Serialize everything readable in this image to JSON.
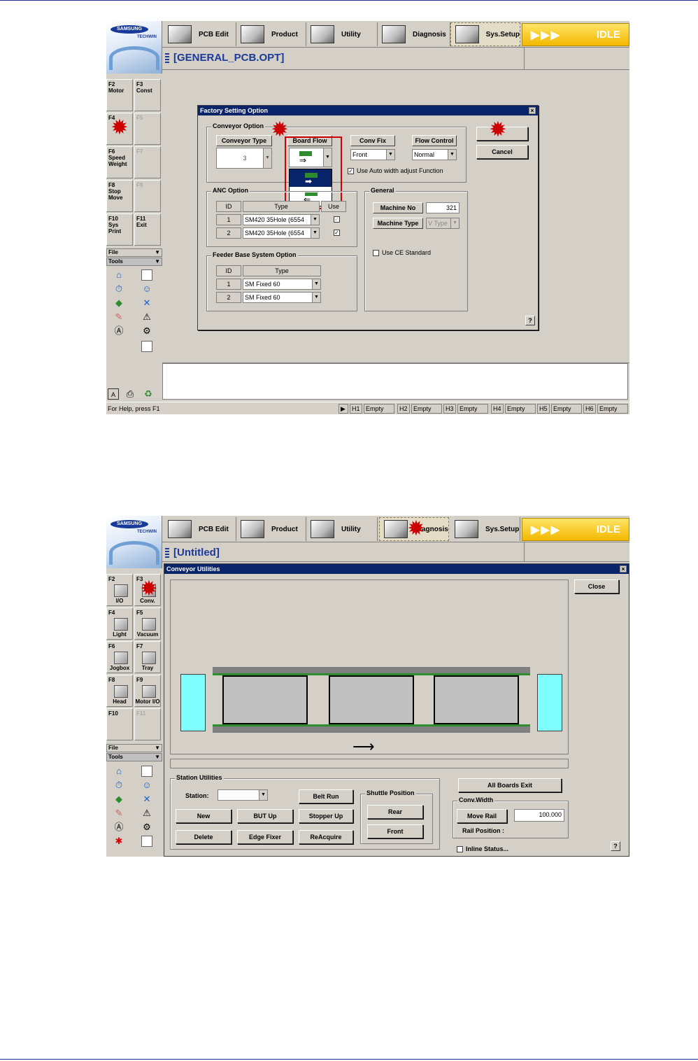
{
  "toolbar": {
    "logo_brand": "SAMSUNG",
    "logo_sub": "TECHWIN",
    "buttons": [
      "PCB Edit",
      "Product",
      "Utility",
      "Diagnosis",
      "Sys.Setup"
    ],
    "status_label": "IDLE",
    "status_arrows": "▶▶▶"
  },
  "screen1": {
    "title": "[GENERAL_PCB.OPT]",
    "fkeys": [
      {
        "key": "F2",
        "label": "Motor"
      },
      {
        "key": "F3",
        "label": "Const"
      },
      {
        "key": "F4",
        "label": ""
      },
      {
        "key": "F5",
        "label": ""
      },
      {
        "key": "F6",
        "label": "Speed\nWeight"
      },
      {
        "key": "F7",
        "label": ""
      },
      {
        "key": "F8",
        "label": "Stop\nMove"
      },
      {
        "key": "F9",
        "label": ""
      },
      {
        "key": "F10",
        "label": "Sys\nPrint"
      },
      {
        "key": "F11",
        "label": "Exit"
      }
    ],
    "menus": {
      "file": "File",
      "tools": "Tools"
    },
    "dialog": {
      "title": "Factory Setting Option",
      "conveyor_group": "Conveyor Option",
      "conveyor_type_label": "Conveyor Type",
      "conveyor_type_value": "3",
      "board_flow_label": "Board Flow",
      "conv_fix_label": "Conv Fix",
      "conv_fix_value": "Front",
      "flow_control_label": "Flow Control",
      "flow_control_value": "Normal",
      "auto_width_label": "Use Auto width adjust Function",
      "ok_label": "",
      "cancel_label": "Cancel",
      "anc_group": "ANC Option",
      "anc_headers": [
        "ID",
        "Type",
        "Use"
      ],
      "anc_rows": [
        {
          "id": "1",
          "type": "SM420 35Hole (6554"
        },
        {
          "id": "2",
          "type": "SM420 35Hole (6554"
        }
      ],
      "feeder_group": "Feeder Base System Option",
      "feeder_headers": [
        "ID",
        "Type"
      ],
      "feeder_rows": [
        {
          "id": "1",
          "type": "SM Fixed 60"
        },
        {
          "id": "2",
          "type": "SM Fixed 60"
        }
      ],
      "general_group": "General",
      "machine_no_label": "Machine No",
      "machine_no_value": "321",
      "machine_type_label": "Machine Type",
      "machine_type_value": "V Type",
      "ce_label": "Use CE Standard",
      "help": "?"
    },
    "statusbar": {
      "help_text": "For Help, press F1",
      "heads": [
        {
          "k": "H1",
          "v": "Empty"
        },
        {
          "k": "H2",
          "v": "Empty"
        },
        {
          "k": "H3",
          "v": "Empty"
        },
        {
          "k": "H4",
          "v": "Empty"
        },
        {
          "k": "H5",
          "v": "Empty"
        },
        {
          "k": "H6",
          "v": "Empty"
        }
      ]
    }
  },
  "screen2": {
    "title": "[Untitled]",
    "fkeys": [
      {
        "key": "F2",
        "label": "I/O"
      },
      {
        "key": "F3",
        "label": "Conv."
      },
      {
        "key": "F4",
        "label": "Light"
      },
      {
        "key": "F5",
        "label": "Vacuum"
      },
      {
        "key": "F6",
        "label": "Jogbox"
      },
      {
        "key": "F7",
        "label": "Tray"
      },
      {
        "key": "F8",
        "label": "Head"
      },
      {
        "key": "F9",
        "label": "Motor I/O"
      },
      {
        "key": "F10",
        "label": ""
      },
      {
        "key": "F11",
        "label": ""
      }
    ],
    "menus": {
      "file": "File",
      "tools": "Tools"
    },
    "dialog": {
      "title": "Conveyor Utilities",
      "close_label": "Close",
      "station_group": "Station Utilities",
      "station_label": "Station:",
      "belt_run": "Belt Run",
      "new": "New",
      "but_up": "BUT Up",
      "stopper_up": "Stopper Up",
      "delete": "Delete",
      "edge_fixer": "Edge Fixer",
      "reacquire": "ReAcquire",
      "shuttle_group": "Shuttle Position",
      "rear": "Rear",
      "front": "Front",
      "all_boards_exit": "All Boards Exit",
      "conv_width_group": "Conv.Width",
      "move_rail": "Move Rail",
      "rail_value": "100.000",
      "rail_position_label": "Rail Position  :",
      "inline_status": "Inline Status...",
      "help": "?"
    }
  },
  "colors": {
    "title_bar": "#0a246a",
    "accent": "#1a3a9a",
    "highlight_box": "#d00000",
    "rail_green": "#2e8b2e",
    "buffer": "#80ffff"
  },
  "annotation_mark": "✹"
}
